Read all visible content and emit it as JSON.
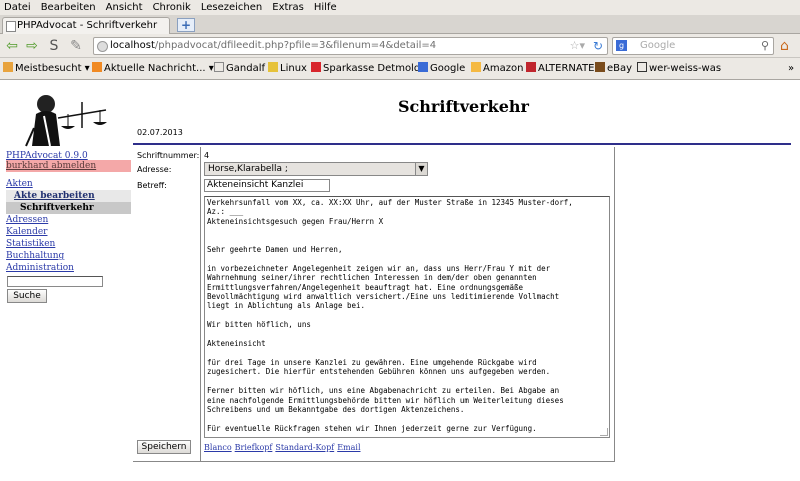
{
  "browser": {
    "menu": [
      "Datei",
      "Bearbeiten",
      "Ansicht",
      "Chronik",
      "Lesezeichen",
      "Extras",
      "Hilfe"
    ],
    "tab_title": "PHPAdvocat - Schriftverkehr",
    "url_host": "localhost",
    "url_path": "/phpadvocat/dfileedit.php?pfile=3&filenum=4&detail=4",
    "search_placeholder": "Google",
    "bookmarks": [
      "Meistbesucht ▾",
      "Aktuelle Nachricht... ▾",
      "Gandalf",
      "Linux",
      "Sparkasse Detmold",
      "Google",
      "Amazon",
      "ALTERNATE",
      "eBay",
      "wer-weiss-was"
    ],
    "bookmarks_more": "»"
  },
  "sidebar": {
    "version": "PHPAdvocat 0.9.0",
    "items": [
      {
        "label": "burkhard abmelden"
      },
      {
        "label": "Akten"
      },
      {
        "label": "Akte bearbeiten"
      },
      {
        "label": "Schriftverkehr"
      },
      {
        "label": "Adressen"
      },
      {
        "label": "Kalender"
      },
      {
        "label": "Statistiken"
      },
      {
        "label": "Buchhaltung"
      },
      {
        "label": "Administration"
      }
    ],
    "search_value": "",
    "search_button": "Suche"
  },
  "main": {
    "title": "Schriftverkehr",
    "date": "02.07.2013",
    "form": {
      "number_label": "Schriftnummer:",
      "number_value": "4",
      "address_label": "Adresse:",
      "address_value": "Horse,Klarabella ;",
      "subject_label": "Betreff:",
      "subject_value": "Akteneinsicht Kanzlei",
      "body": "Verkehrsunfall vom XX, ca. XX:XX Uhr, auf der Muster Straße in 12345 Muster-dorf,\nAz.: ___\nAkteneinsichtsgesuch gegen Frau/Herrn X\n\n\nSehr geehrte Damen und Herren,\n\nin vorbezeichneter Angelegenheit zeigen wir an, dass uns Herr/Frau Y mit der\nWahrnehmung seiner/ihrer rechtlichen Interessen in dem/der oben genannten\nErmittlungsverfahren/Angelegenheit beauftragt hat. Eine ordnungsgemäße\nBevollmächtigung wird anwaltlich versichert./Eine uns leditimierende Vollmacht\nliegt in Ablichtung als Anlage bei.\n\nWir bitten höflich, uns\n\nAkteneinsicht\n\nfür drei Tage in unsere Kanzlei zu gewähren. Eine umgehende Rückgabe wird\nzugesichert. Die hierfür entstehenden Gebühren können uns aufgegeben werden.\n\nFerner bitten wir höflich, uns eine Abgabenachricht zu erteilen. Bei Abgabe an\neine nachfolgende Ermittlungsbehörde bitten wir höflich um Weiterleitung dieses\nSchreibens und um Bekanntgabe des dortigen Aktenzeichens.\n\nFür eventuelle Rückfragen stehen wir Ihnen jederzeit gerne zur Verfügung.",
      "save_button": "Speichern",
      "links": [
        "Blanco",
        "Briefkopf",
        "Standard-Kopf",
        "Email"
      ]
    }
  }
}
